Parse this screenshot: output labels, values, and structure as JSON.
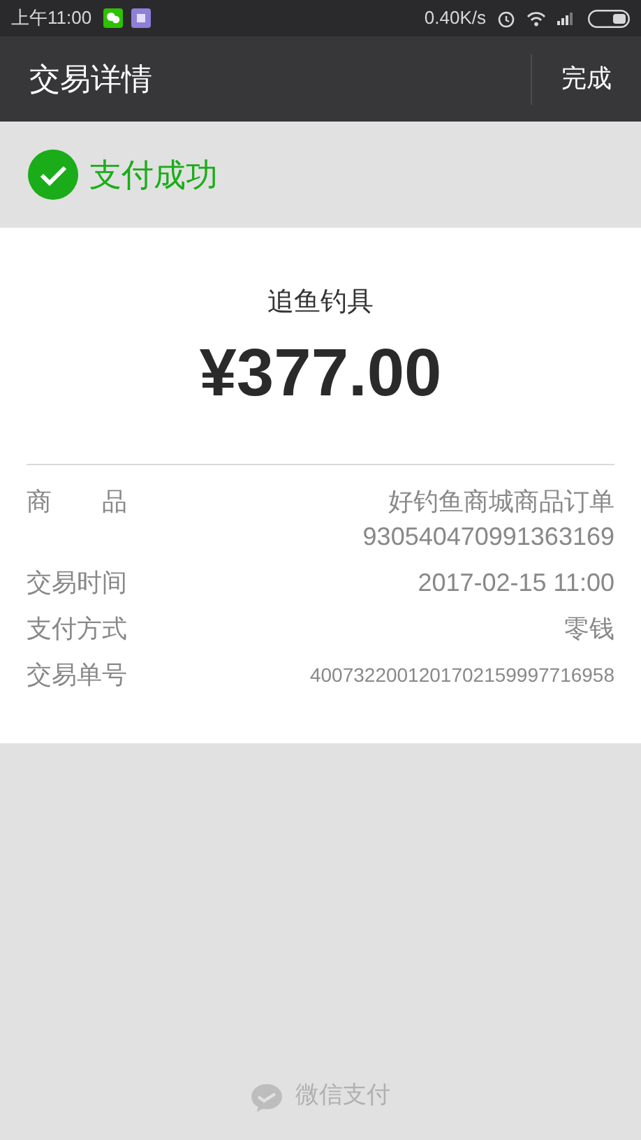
{
  "status_bar": {
    "time": "上午11:00",
    "speed": "0.40K/s"
  },
  "nav": {
    "title": "交易详情",
    "done": "完成"
  },
  "result": {
    "text": "支付成功"
  },
  "payee": "追鱼钓具",
  "amount": "¥377.00",
  "details": [
    {
      "label": "商　　品",
      "value": "好钓鱼商城商品订单\n930540470991363169",
      "kind": "normal"
    },
    {
      "label": "交易时间",
      "value": "2017-02-15 11:00",
      "kind": "normal"
    },
    {
      "label": "支付方式",
      "value": "零钱",
      "kind": "normal"
    },
    {
      "label": "交易单号",
      "value": "4007322001201702159997716958",
      "kind": "small"
    }
  ],
  "footer": {
    "text": "微信支付"
  }
}
